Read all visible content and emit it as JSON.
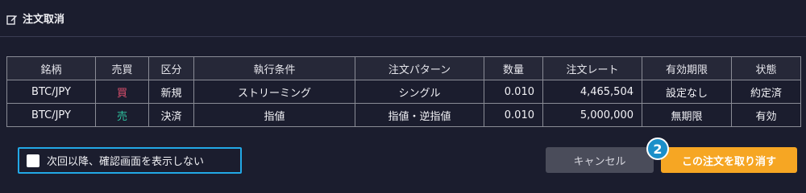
{
  "header": {
    "title": "注文取消",
    "icon": "edit-icon"
  },
  "table": {
    "columns": [
      "銘柄",
      "売買",
      "区分",
      "執行条件",
      "注文パターン",
      "数量",
      "注文レート",
      "有効期限",
      "状態"
    ],
    "rows": [
      [
        "BTC/JPY",
        "買",
        "新規",
        "ストリーミング",
        "シングル",
        "0.010",
        "4,465,504",
        "設定なし",
        "約定済"
      ],
      [
        "BTC/JPY",
        "売",
        "決済",
        "指値",
        "指値・逆指値",
        "0.010",
        "5,000,000",
        "無期限",
        "有効"
      ]
    ]
  },
  "checkbox": {
    "label": "次回以降、確認画面を表示しない",
    "checked": false
  },
  "buttons": {
    "cancel": "キャンセル",
    "confirm": "この注文を取り消す"
  },
  "badge": {
    "number": "2"
  },
  "colors": {
    "buy": "#e0506e",
    "sell": "#2ec4a0",
    "confirm": "#f6a623",
    "highlight": "#22a8e6",
    "badge": "#1c8fc9"
  }
}
